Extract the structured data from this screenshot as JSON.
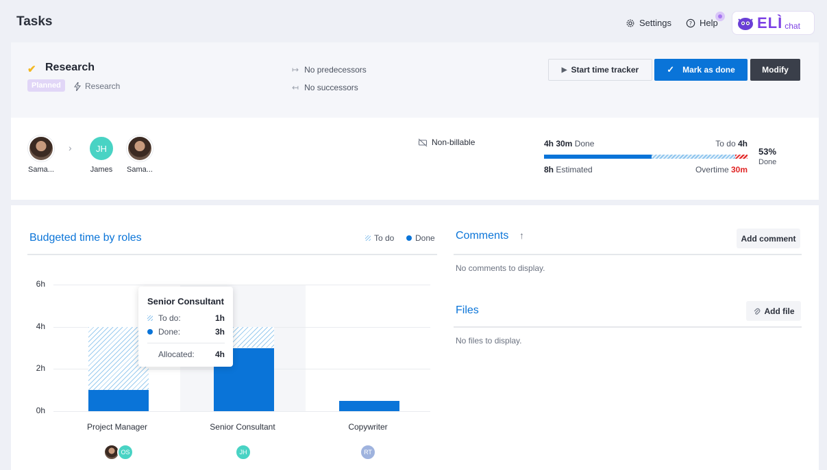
{
  "header": {
    "title": "Tasks",
    "settings_label": "Settings",
    "help_label": "Help",
    "eli_label": "ELÌ",
    "eli_chat_label": "chat"
  },
  "task": {
    "title": "Research",
    "status_badge": "Planned",
    "category": "Research",
    "predecessors": "No predecessors",
    "successors": "No successors",
    "start_tracker_label": "Start time tracker",
    "mark_done_label": "Mark as done",
    "modify_label": "Modify"
  },
  "info": {
    "assignees": [
      {
        "name": "Sama...",
        "initials": ""
      },
      {
        "name": "James",
        "initials": "JH"
      },
      {
        "name": "Sama...",
        "initials": ""
      }
    ],
    "billing": "Non-billable",
    "done_value": "4h 30m",
    "done_label": "Done",
    "todo_label": "To do",
    "todo_value": "4h",
    "estimated_value": "8h",
    "estimated_label": "Estimated",
    "overtime_label": "Overtime",
    "overtime_value": "30m",
    "done_percent": "53%",
    "done_percent_label": "Done",
    "progress": {
      "done_fraction": 0.53,
      "todo_fraction": 0.41,
      "overtime_fraction": 0.06
    }
  },
  "chart_section": {
    "title": "Budgeted time by roles",
    "legend_todo": "To do",
    "legend_done": "Done"
  },
  "chart_data": {
    "type": "bar",
    "stacked": true,
    "categories": [
      "Project Manager",
      "Senior Consultant",
      "Copywriter"
    ],
    "series": [
      {
        "name": "Done",
        "values": [
          1,
          3,
          0.5
        ]
      },
      {
        "name": "To do",
        "values": [
          3,
          1,
          0
        ]
      }
    ],
    "y_ticks": [
      "0h",
      "2h",
      "4h",
      "6h"
    ],
    "ylim": [
      0,
      6
    ],
    "grid": true,
    "legend_position": "top-right",
    "colors": {
      "done": "#0a74d8",
      "todo": "#9acbef"
    }
  },
  "tooltip": {
    "title": "Senior Consultant",
    "todo_label": "To do:",
    "todo_value": "1h",
    "done_label": "Done:",
    "done_value": "3h",
    "allocated_label": "Allocated:",
    "allocated_value": "4h"
  },
  "role_assignees": [
    [
      "",
      "OS"
    ],
    [
      "JH"
    ],
    [
      "RT"
    ]
  ],
  "comments": {
    "title": "Comments",
    "sort_icon": "arrow-up-icon",
    "add_label": "Add comment",
    "empty": "No comments to display."
  },
  "files": {
    "title": "Files",
    "add_label": "Add file",
    "empty": "No files to display."
  }
}
